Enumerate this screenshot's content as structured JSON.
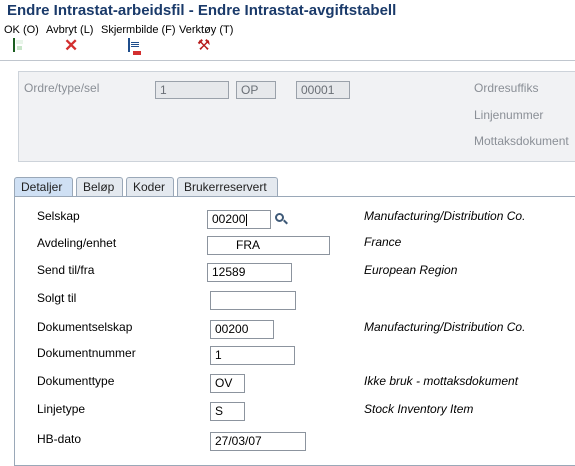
{
  "window": {
    "title": "Endre Intrastat-arbeidsfil - Endre Intrastat-avgiftstabell"
  },
  "toolbar": {
    "ok_label": "OK (O)",
    "cancel_label": "Avbryt (L)",
    "screen_label": "Skjermbilde (F)",
    "tools_label": "Verktøy (T)"
  },
  "header": {
    "order_label": "Ordre/type/sel",
    "order_number": "1",
    "order_type": "OP",
    "order_suffix_value": "00001",
    "order_suffix_label": "Ordresuffiks",
    "line_number_label": "Linjenummer",
    "receipt_doc_label": "Mottaksdokument"
  },
  "tabs": [
    {
      "label": "Detaljer"
    },
    {
      "label": "Beløp"
    },
    {
      "label": "Koder"
    },
    {
      "label": "Brukerreservert"
    }
  ],
  "details": {
    "company": {
      "label": "Selskap",
      "value": "00200",
      "desc": "Manufacturing/Distribution Co."
    },
    "business_unit": {
      "label": "Avdeling/enhet",
      "value": "FRA",
      "desc": "France"
    },
    "ship_to": {
      "label": "Send til/fra",
      "value": "12589",
      "desc": "European Region"
    },
    "sold_to": {
      "label": "Solgt til",
      "value": ""
    },
    "doc_company": {
      "label": "Dokumentselskap",
      "value": "00200",
      "desc": "Manufacturing/Distribution Co."
    },
    "doc_number": {
      "label": "Dokumentnummer",
      "value": "1"
    },
    "doc_type": {
      "label": "Dokumenttype",
      "value": "OV",
      "desc": "Ikke bruk - mottaksdokument"
    },
    "line_type": {
      "label": "Linjetype",
      "value": "S",
      "desc": "Stock Inventory Item"
    },
    "gl_date": {
      "label": "HB-dato",
      "value": "27/03/07"
    }
  }
}
